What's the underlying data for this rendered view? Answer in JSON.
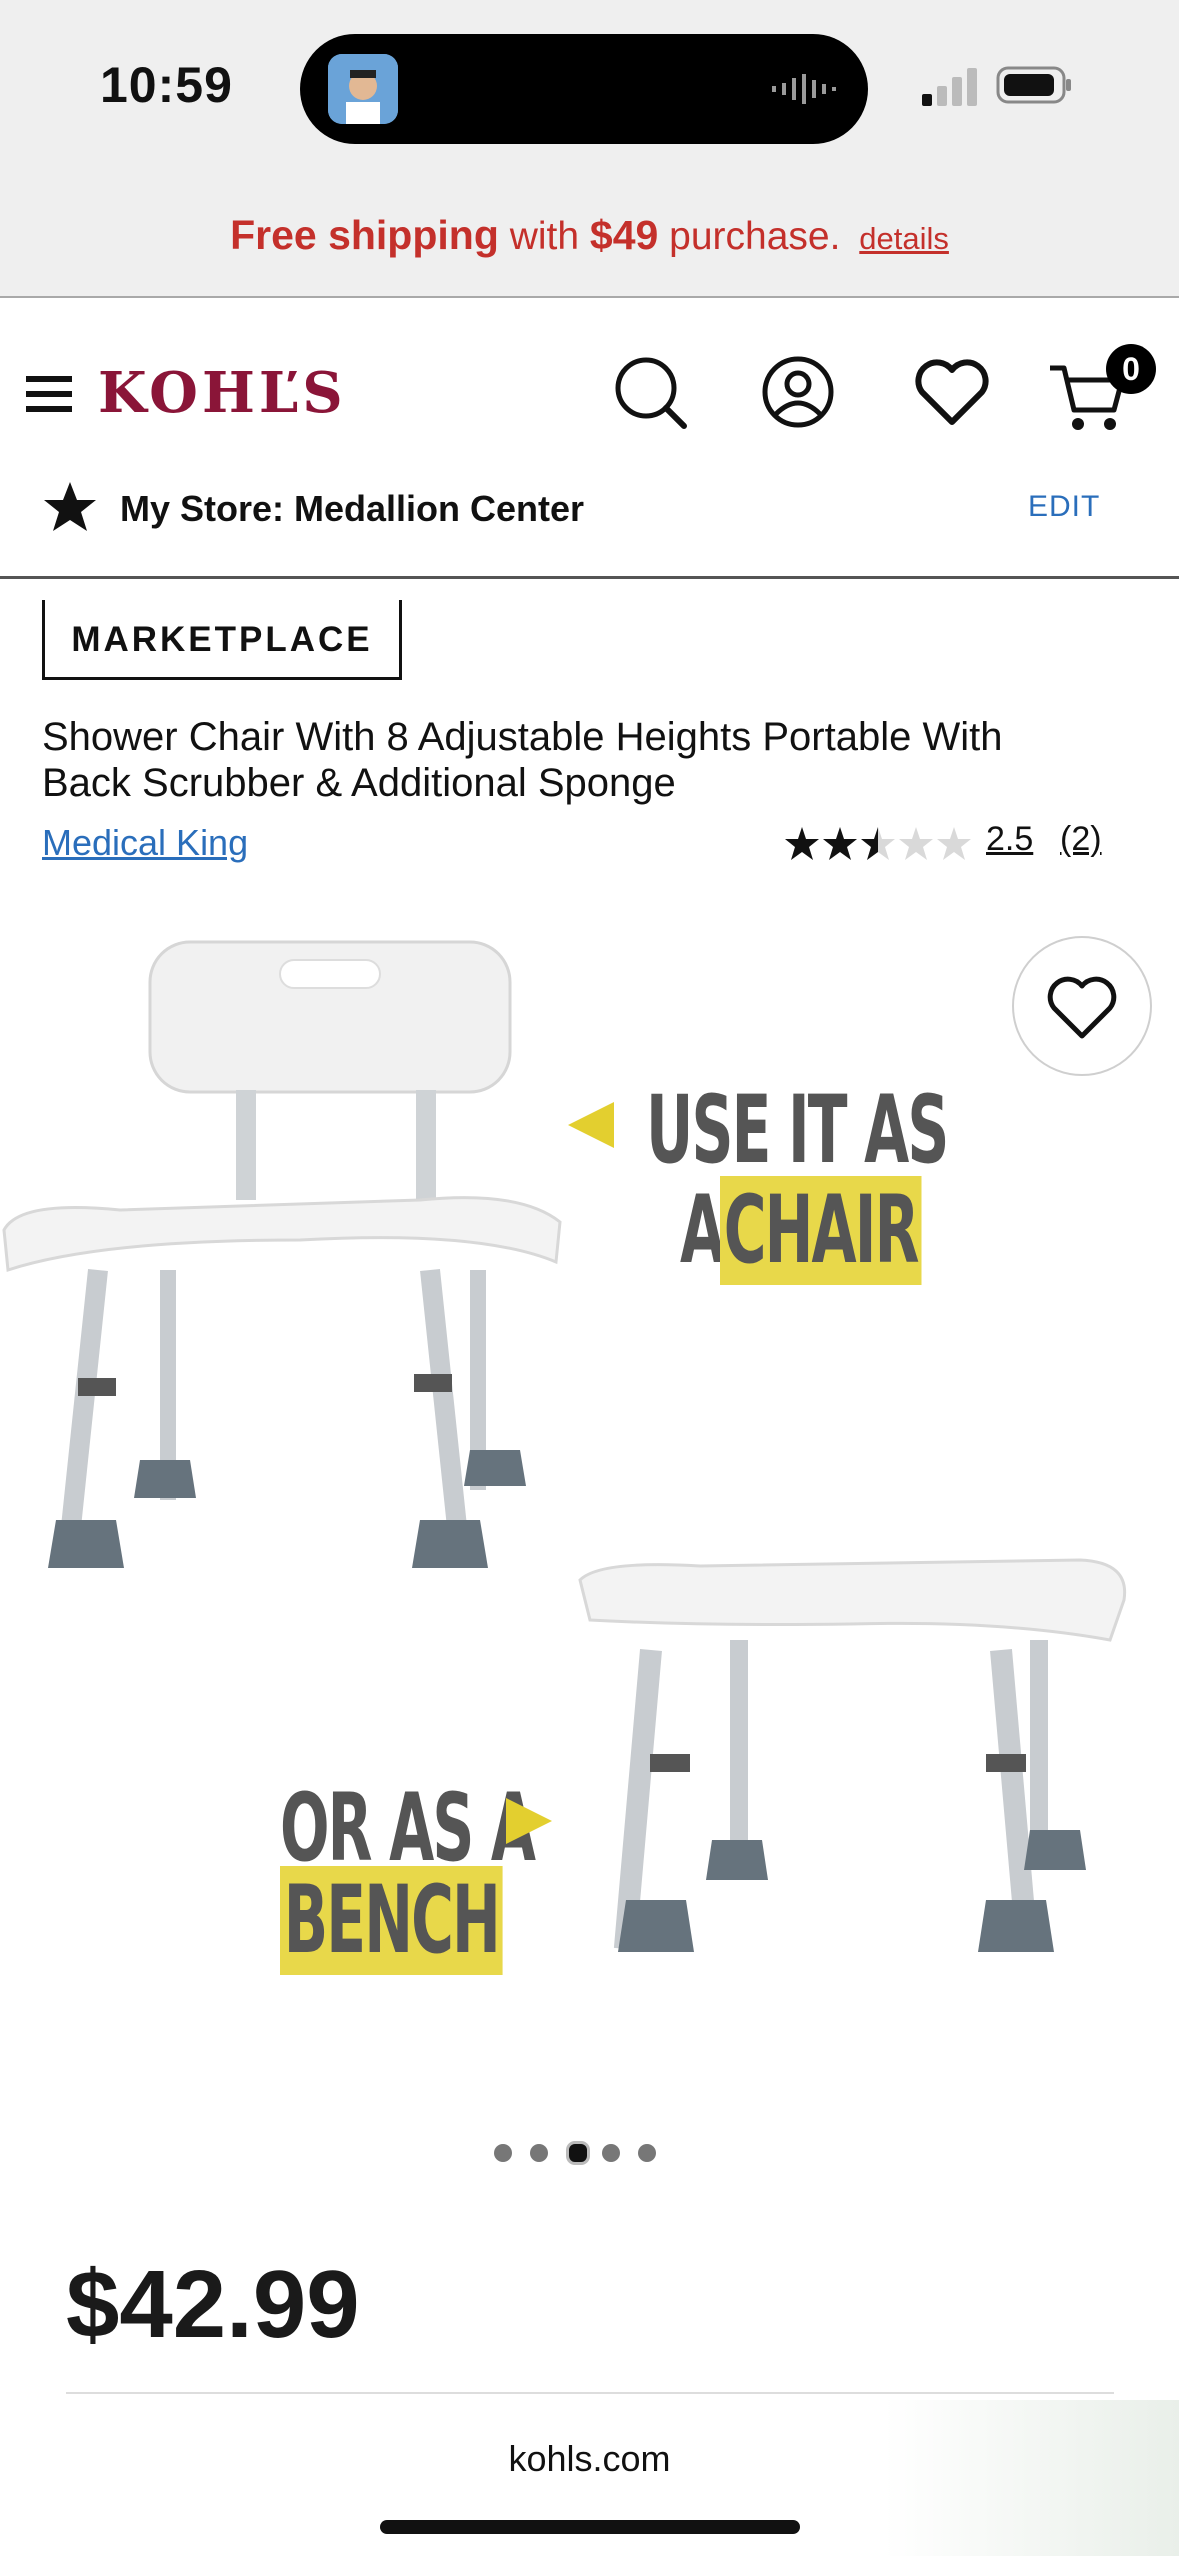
{
  "status": {
    "time": "10:59"
  },
  "promo": {
    "strong": "Free shipping",
    "mid": " with ",
    "amount": "$49",
    "tail": " purchase.",
    "link": "details"
  },
  "header": {
    "logo": "KOHĽS",
    "cart_count": "0"
  },
  "store": {
    "label": "My Store: Medallion Center",
    "edit": "EDIT"
  },
  "product": {
    "badge": "MARKETPLACE",
    "title": "Shower Chair With 8 Adjustable Heights Portable With Back Scrubber & Additional Sponge",
    "brand": "Medical King",
    "rating": {
      "value": "2.5",
      "count": "(2)",
      "stars": 2.5
    },
    "image_captions": {
      "line1": "USE IT AS",
      "line2a": "A",
      "line2b": "CHAIR",
      "line3": "OR AS A",
      "line4": "BENCH"
    },
    "carousel": {
      "total": 5,
      "active": 3
    },
    "price": "$42.99"
  },
  "browser": {
    "url": "kohls.com"
  },
  "colors": {
    "brand": "#8a1538",
    "promo": "#c4302b",
    "link": "#2a6ebb"
  }
}
